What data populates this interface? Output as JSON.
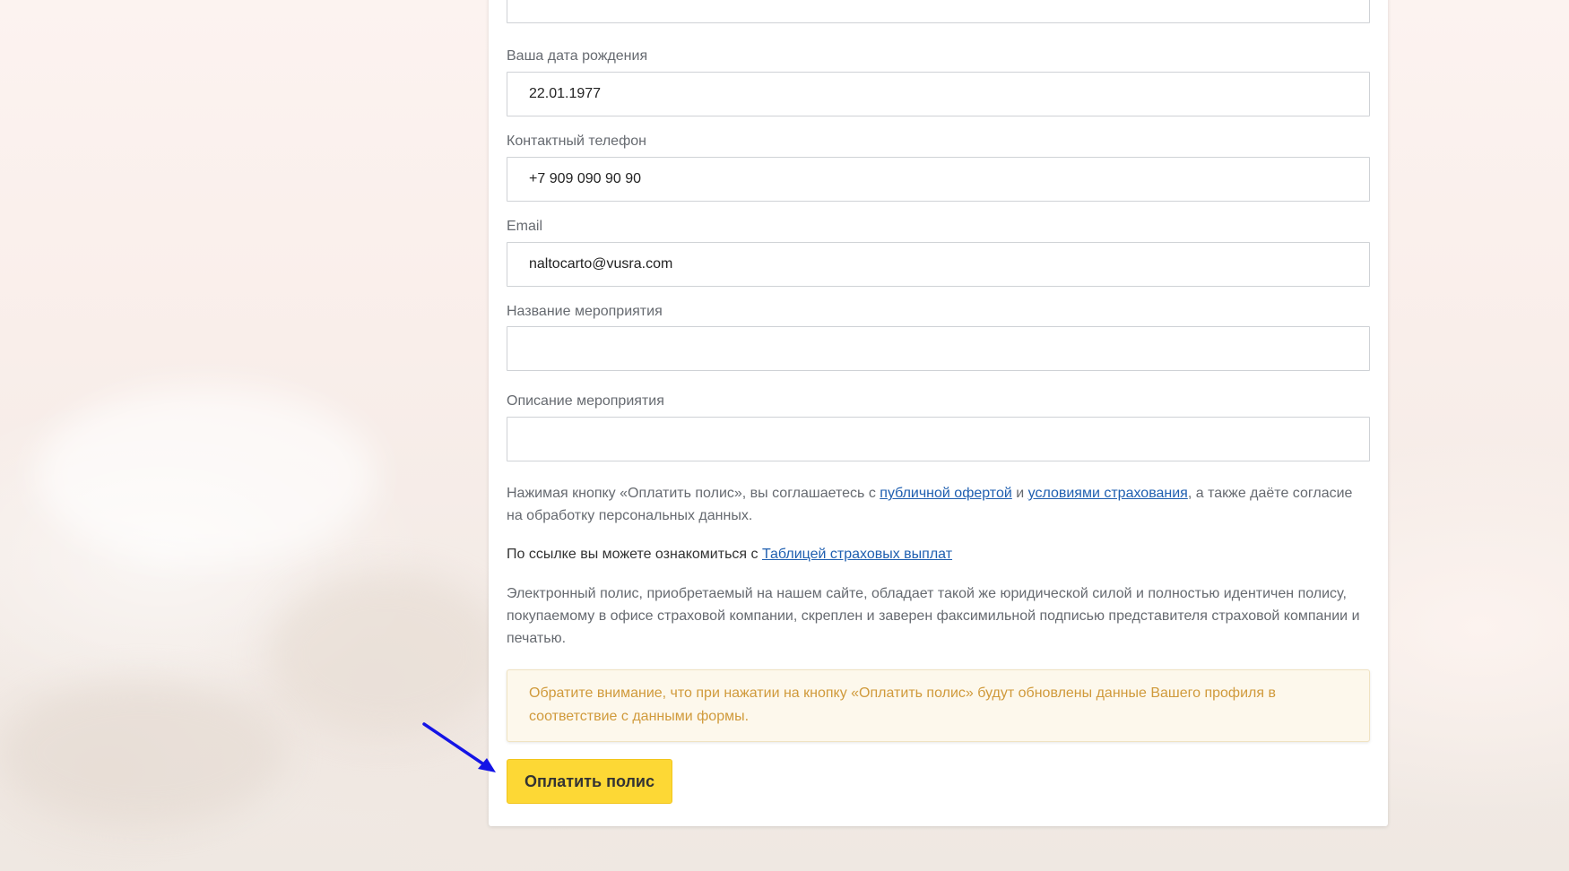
{
  "form": {
    "fields": [
      {
        "label": "",
        "value": "",
        "placeholder": ""
      },
      {
        "label": "Ваша дата рождения",
        "value": "22.01.1977",
        "placeholder": ""
      },
      {
        "label": "Контактный телефон",
        "value": "+7 909 090 90 90",
        "placeholder": ""
      },
      {
        "label": "Email",
        "value": "naltocarto@vusra.com",
        "placeholder": ""
      },
      {
        "label": "Название мероприятия",
        "value": "",
        "placeholder": ""
      },
      {
        "label": "Описание мероприятия",
        "value": "",
        "placeholder": ""
      }
    ]
  },
  "agreement": {
    "text_before": "Нажимая кнопку «Оплатить полис», вы соглашаетесь с ",
    "offer_link": "публичной офертой",
    "text_and": " и ",
    "terms_link": "условиями страхования",
    "text_after": ", а также даёте согласие на обработку персональных данных."
  },
  "payouts": {
    "text_before": "По ссылке вы можете ознакомиться с ",
    "table_link": "Таблицей страховых выплат"
  },
  "legal_note": "Электронный полис, приобретаемый на нашем сайте, обладает такой же юридической силой и полностью идентичен полису, покупаемому в офисе страховой компании, скреплен и заверен факсимильной подписью представителя страховой компании и печатью.",
  "notice": "Обратите внимание, что при нажатии на кнопку «Оплатить полис» будут обновлены данные Вашего профиля в соответствие с данными формы.",
  "pay_button": "Оплатить полис",
  "colors": {
    "button_bg": "#fdd835",
    "link": "#1f5fb0",
    "notice_text": "#d09a3b",
    "arrow": "#1414e6"
  },
  "icons": {
    "annotation": "arrow-icon"
  }
}
